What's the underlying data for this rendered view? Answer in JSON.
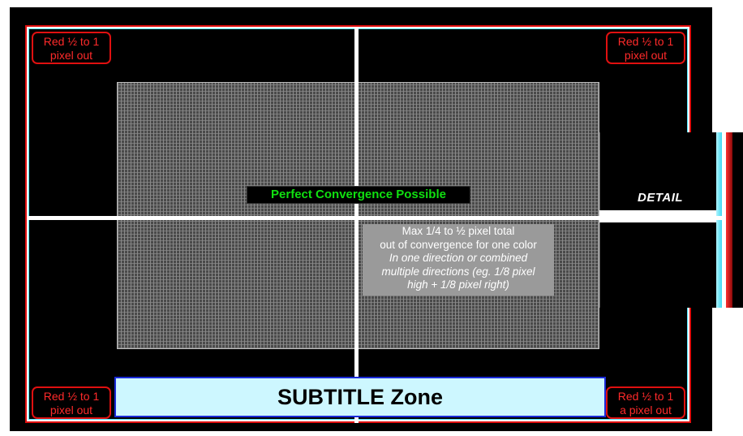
{
  "corner_labels": {
    "top_left": {
      "line1": "Red ½ to 1",
      "line2": "pixel out"
    },
    "top_right": {
      "line1": "Red ½ to 1",
      "line2": "pixel out"
    },
    "bottom_left": {
      "line1": "Red ½ to 1",
      "line2": "pixel out"
    },
    "bottom_right": {
      "line1": "Red ½ to 1",
      "line2": "a pixel out"
    }
  },
  "center": {
    "perfect_label": "Perfect Convergence Possible"
  },
  "info_box": {
    "line1": "Max 1/4 to ½ pixel total",
    "line2": "out of convergence for one color",
    "line3": "In one direction or combined",
    "line4": "multiple directions (eg. 1/8 pixel",
    "line5": "high + 1/8 pixel right)"
  },
  "detail": {
    "label": "DETAIL"
  },
  "subtitle_zone": {
    "label": "SUBTITLE Zone"
  },
  "colors": {
    "background": "#000000",
    "frame_red": "#e01010",
    "frame_cyan": "#4fe8ff",
    "perfect_text": "#10e010",
    "corner_text": "#ff2a2a",
    "subtitle_fill": "#cdf7ff",
    "subtitle_border": "#1a2ad8"
  }
}
